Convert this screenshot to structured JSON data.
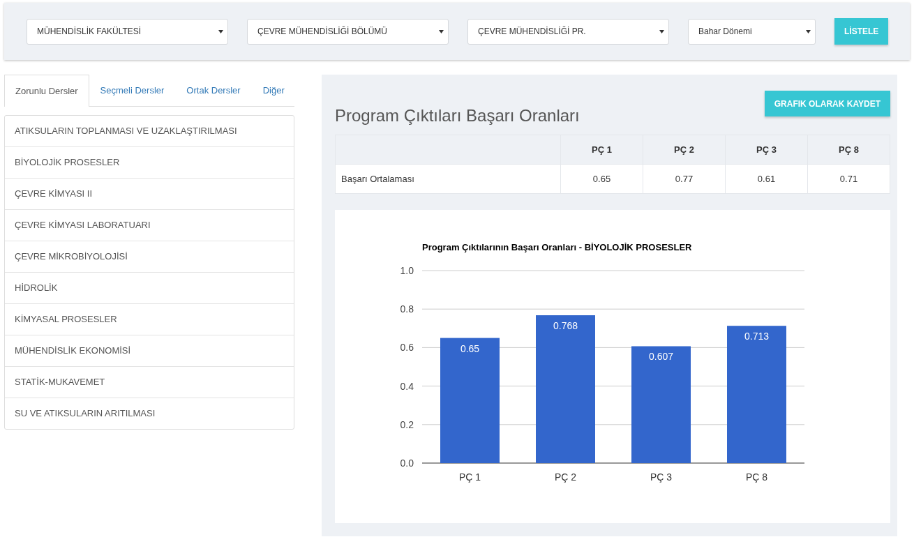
{
  "filters": [
    {
      "value": "MÜHENDİSLİK FAKÜLTESİ"
    },
    {
      "value": "ÇEVRE MÜHENDİSLİĞİ BÖLÜMÜ"
    },
    {
      "value": "ÇEVRE MÜHENDİSLİĞİ PR."
    },
    {
      "value": "Bahar Dönemi"
    }
  ],
  "list_button": "LİSTELE",
  "tabs": [
    {
      "label": "Zorunlu Dersler",
      "selected": true
    },
    {
      "label": "Seçmeli Dersler",
      "selected": false
    },
    {
      "label": "Ortak Dersler",
      "selected": false
    },
    {
      "label": "Diğer",
      "selected": false
    }
  ],
  "courses": [
    "ATIKSULARIN TOPLANMASI VE UZAKLAŞTIRILMASI",
    "BİYOLOJİK PROSESLER",
    "ÇEVRE KİMYASI II",
    "ÇEVRE KİMYASI LABORATUARI",
    "ÇEVRE MİKROBİYOLOJİSİ",
    "HİDROLİK",
    "KİMYASAL PROSESLER",
    "MÜHENDİSLİK EKONOMİSİ",
    "STATİK-MUKAVEMET",
    "SU VE ATIKSULARIN ARITILMASI"
  ],
  "panel": {
    "title": "Program Çıktıları Başarı Oranları",
    "save_button": "GRAFIK OLARAK KAYDET",
    "table": {
      "columns": [
        "PÇ 1",
        "PÇ 2",
        "PÇ 3",
        "PÇ 8"
      ],
      "rows": [
        {
          "label": "Başarı Ortalaması",
          "values": [
            "0.65",
            "0.77",
            "0.61",
            "0.71"
          ]
        }
      ]
    },
    "chart_data": {
      "type": "bar",
      "title": "Program Çıktılarının Başarı Oranları - BİYOLOJİK PROSESLER",
      "categories": [
        "PÇ 1",
        "PÇ 2",
        "PÇ 3",
        "PÇ 8"
      ],
      "series": [
        {
          "color": "#3366cc",
          "values": [
            0.65,
            0.768,
            0.607,
            0.713
          ]
        }
      ],
      "grid": true,
      "ylim": [
        0,
        1
      ],
      "yticks": [
        {
          "value": 0,
          "label": "0.0"
        },
        {
          "value": 0.2,
          "label": "0.2"
        },
        {
          "value": 0.4,
          "label": "0.4"
        },
        {
          "value": 0.6,
          "label": "0.6"
        },
        {
          "value": 0.8,
          "label": "0.8"
        },
        {
          "value": 1,
          "label": "1.0"
        }
      ],
      "data_labels": true
    }
  }
}
